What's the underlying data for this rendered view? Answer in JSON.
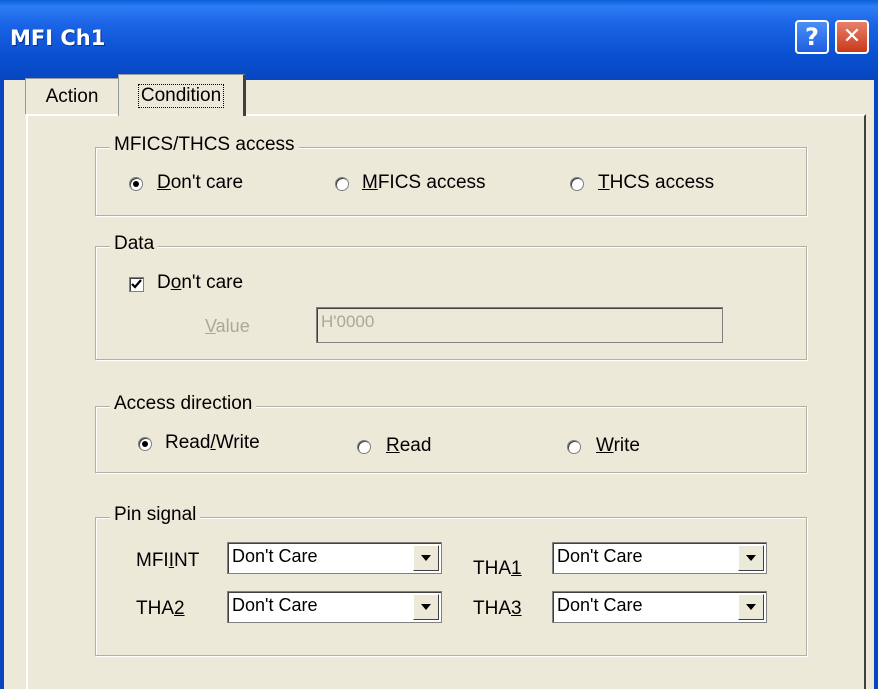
{
  "window": {
    "title": "MFI Ch1",
    "help_glyph": "?",
    "close_glyph": "✕"
  },
  "tabs": [
    {
      "label": "Action"
    },
    {
      "label": "Condition"
    }
  ],
  "access_group": {
    "legend": "MFICS/THCS access",
    "options": [
      {
        "pre": "",
        "mn": "D",
        "post": "on't care",
        "selected": true
      },
      {
        "pre": "",
        "mn": "M",
        "post": "FICS access",
        "selected": false
      },
      {
        "pre": "",
        "mn": "T",
        "post": "HCS access",
        "selected": false
      }
    ]
  },
  "data_group": {
    "legend": "Data",
    "dont_care": {
      "pre": "D",
      "mn": "o",
      "post": "n't care",
      "checked": true
    },
    "value_label": {
      "mn": "V",
      "post": "alue"
    },
    "value": "H'0000"
  },
  "direction_group": {
    "legend": "Access direction",
    "options": [
      {
        "pre": "Read",
        "mn": "/",
        "post": "Write",
        "selected": true
      },
      {
        "pre": "",
        "mn": "R",
        "post": "ead",
        "selected": false
      },
      {
        "pre": "",
        "mn": "W",
        "post": "rite",
        "selected": false
      }
    ]
  },
  "pin_group": {
    "legend": "Pin signal",
    "mfiint": {
      "pre": "MFI",
      "mn": "I",
      "post": "NT",
      "value": "Don't Care"
    },
    "tha1": {
      "pre": "THA",
      "mn": "1",
      "post": "",
      "value": "Don't Care"
    },
    "tha2": {
      "pre": "THA",
      "mn": "2",
      "post": "",
      "value": "Don't Care"
    },
    "tha3": {
      "pre": "THA",
      "mn": "3",
      "post": "",
      "value": "Don't Care"
    }
  }
}
